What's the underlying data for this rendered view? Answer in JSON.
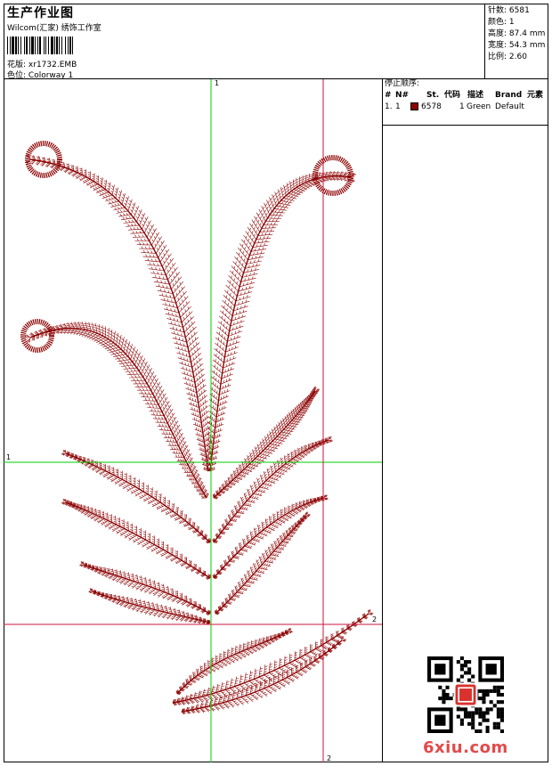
{
  "header": {
    "title": "生产作业图",
    "studio": "Wilcom(汇家) 绣饰工作室",
    "design_label": "花版:",
    "design_value": "xr1732.EMB",
    "colorway_label": "色位:",
    "colorway_value": "Colorway 1"
  },
  "stats": {
    "stitches_label": "针数:",
    "stitches_value": "6581",
    "colors_label": "颜色:",
    "colors_value": "1",
    "height_label": "高度:",
    "height_value": "87.4 mm",
    "width_label": "宽度:",
    "width_value": "54.3 mm",
    "scale_label": "比例:",
    "scale_value": "2.60"
  },
  "stop_sequence": {
    "title": "停止顺序:",
    "columns": [
      "#",
      "N#",
      "St.",
      "代码",
      "描述",
      "Brand",
      "元素"
    ],
    "rows": [
      {
        "index": "1.",
        "n": "1",
        "swatch": "#8b0000",
        "st": "6578",
        "code": "1",
        "desc": "Green",
        "brand": "Default"
      }
    ]
  },
  "crosshair": {
    "top_label": "1",
    "left_label": "1",
    "right_label": "2",
    "bottom_label": "2",
    "green": "#00cc00",
    "red": "#c8143c"
  },
  "thread_color": "#8b0000",
  "watermark": "6xiu.com"
}
